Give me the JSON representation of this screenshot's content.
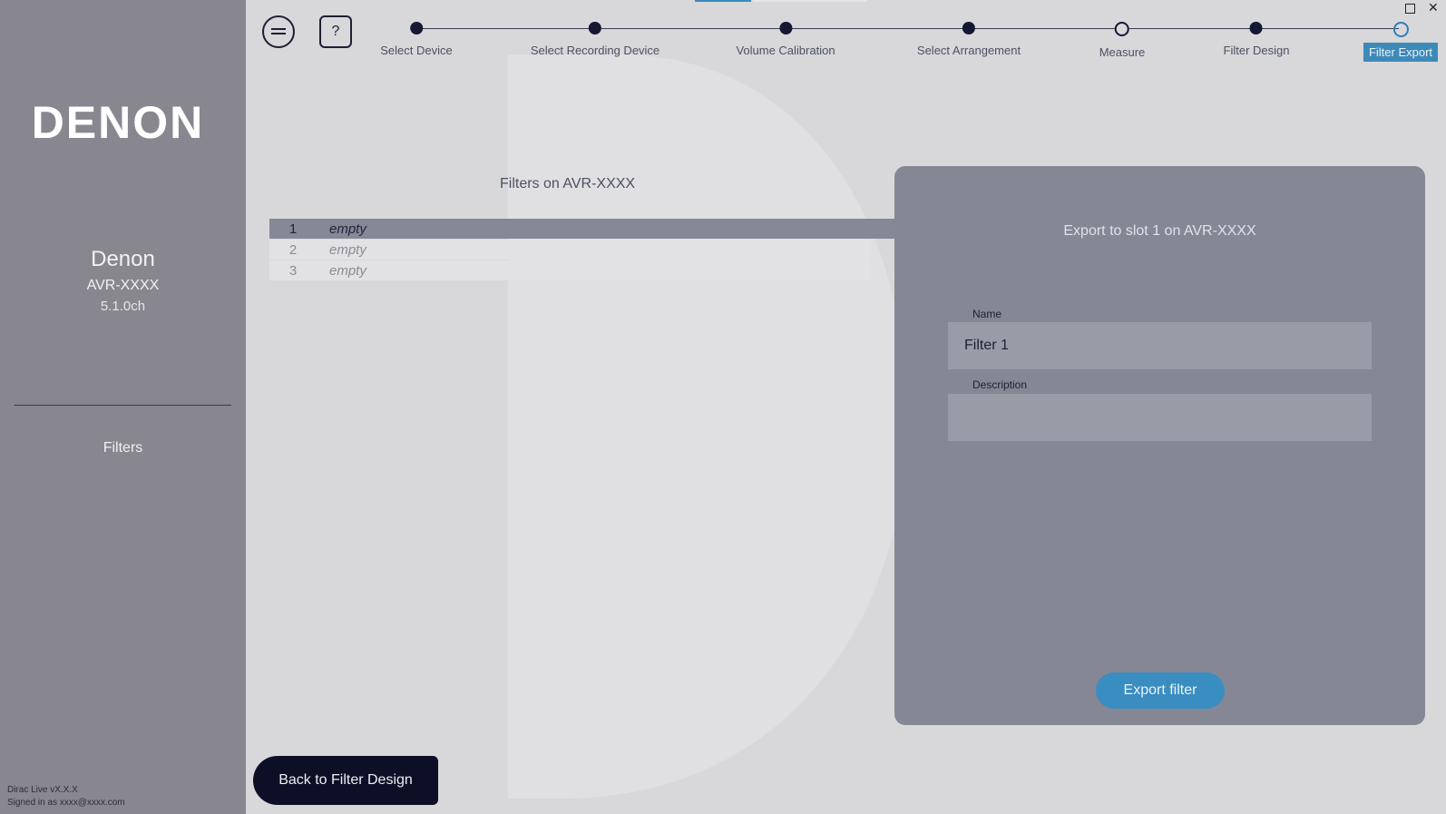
{
  "sidebar": {
    "logo": "DENON",
    "device_brand": "Denon",
    "device_model": "AVR-XXXX",
    "device_channels": "5.1.0ch",
    "nav_filters": "Filters",
    "version": "Dirac Live vX.X.X",
    "signed_in": "Signed in as xxxx@xxxx.com"
  },
  "toolbar": {
    "menu_icon": "menu-icon",
    "help_icon": "help-icon",
    "help_glyph": "?"
  },
  "stepper": {
    "steps": [
      {
        "label": "Select Device",
        "state": "done"
      },
      {
        "label": "Select Recording Device",
        "state": "done"
      },
      {
        "label": "Volume Calibration",
        "state": "done"
      },
      {
        "label": "Select Arrangement",
        "state": "done"
      },
      {
        "label": "Measure",
        "state": "open"
      },
      {
        "label": "Filter Design",
        "state": "done"
      },
      {
        "label": "Filter Export",
        "state": "current"
      }
    ]
  },
  "filters": {
    "title": "Filters on AVR-XXXX",
    "rows": [
      {
        "slot": "1",
        "value": "empty",
        "selected": true
      },
      {
        "slot": "2",
        "value": "empty",
        "selected": false
      },
      {
        "slot": "3",
        "value": "empty",
        "selected": false
      }
    ]
  },
  "export": {
    "title": "Export to slot 1 on AVR-XXXX",
    "name_label": "Name",
    "name_value": "Filter 1",
    "description_label": "Description",
    "description_value": "",
    "button": "Export filter"
  },
  "footer": {
    "back_button": "Back to Filter Design"
  },
  "window": {
    "maximize_icon": "maximize-icon",
    "close_glyph": "✕"
  },
  "colors": {
    "accent": "#3a8dc0",
    "sidebar": "#88868f",
    "panel": "#858794",
    "dark": "#0d0f26"
  }
}
